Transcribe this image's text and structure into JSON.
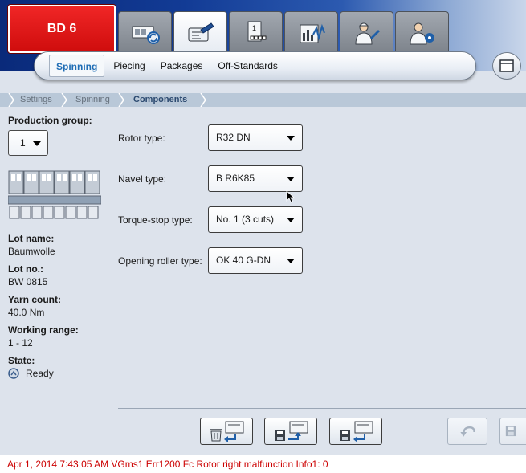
{
  "machine": {
    "name": "BD 6",
    "color": "#d91414"
  },
  "nav_tabs": [
    {
      "name": "machine-overview-icon",
      "active": false
    },
    {
      "name": "settings-card-icon",
      "active": true
    },
    {
      "name": "production-groups-icon",
      "active": false
    },
    {
      "name": "statistics-chart-icon",
      "active": false
    },
    {
      "name": "service-technician-icon",
      "active": false
    },
    {
      "name": "user-settings-icon",
      "active": false
    }
  ],
  "subtabs": [
    "Spinning",
    "Piecing",
    "Packages",
    "Off-Standards"
  ],
  "active_subtab": "Spinning",
  "breadcrumb": [
    "Settings",
    "Spinning",
    "Components"
  ],
  "left_panel": {
    "production_group_label": "Production group:",
    "production_group_value": "1",
    "lot_name_label": "Lot name:",
    "lot_name_value": "Baumwolle",
    "lot_no_label": "Lot no.:",
    "lot_no_value": "BW 0815",
    "yarn_count_label": "Yarn count:",
    "yarn_count_value": "40.0 Nm",
    "working_range_label": "Working range:",
    "working_range_value": "1 - 12",
    "state_label": "State:",
    "state_value": "Ready"
  },
  "form": {
    "rotor_type_label": "Rotor type:",
    "rotor_type_value": "R32 DN",
    "navel_type_label": "Navel type:",
    "navel_type_value": "B R6K85",
    "torque_stop_label": "Torque-stop type:",
    "torque_stop_value": "No. 1 (3 cuts)",
    "opening_roller_label": "Opening roller type:",
    "opening_roller_value": "OK 40 G-DN"
  },
  "action_buttons": [
    {
      "name": "delete-from-machine-icon",
      "enabled": true
    },
    {
      "name": "save-to-machine-icon",
      "enabled": true
    },
    {
      "name": "load-from-machine-icon",
      "enabled": true
    },
    {
      "name": "undo-icon",
      "enabled": false
    },
    {
      "name": "save-icon",
      "enabled": false
    }
  ],
  "status_message": "Apr 1, 2014 7:43:05 AM VGms1 Err1200 Fc Rotor right malfunction Info1: 0",
  "colors": {
    "accent_blue": "#1f6db5",
    "status_text": "#cc0000",
    "header_dark": "#0a2a7a",
    "background": "#dde3ec"
  }
}
